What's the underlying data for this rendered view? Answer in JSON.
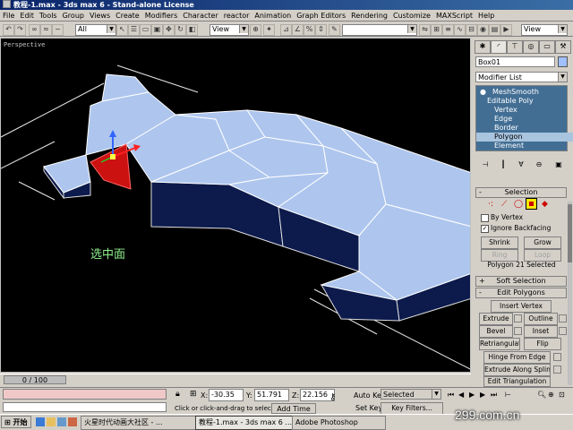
{
  "window": {
    "title": "教程-1.max - 3ds max 6 - Stand-alone License"
  },
  "menu": [
    "File",
    "Edit",
    "Tools",
    "Group",
    "Views",
    "Create",
    "Modifiers",
    "Character",
    "reactor",
    "Animation",
    "Graph Editors",
    "Rendering",
    "Customize",
    "MAXScript",
    "Help"
  ],
  "toolbar": {
    "filter_value": "All",
    "refcoord_value": "View",
    "named_sel_value": "",
    "right_view_value": "View"
  },
  "viewport": {
    "label": "Perspective",
    "annotation": "选中面"
  },
  "command_panel": {
    "object_name": "Box01",
    "modifier_list_label": "Modifier List",
    "stack": [
      {
        "label": "MeshSmooth",
        "selected": false
      },
      {
        "label": "Editable Poly",
        "selected": false
      },
      {
        "label": "Vertex",
        "selected": false
      },
      {
        "label": "Edge",
        "selected": false
      },
      {
        "label": "Border",
        "selected": false
      },
      {
        "label": "Polygon",
        "selected": true
      },
      {
        "label": "Element",
        "selected": false
      }
    ],
    "selection_rollout": "Selection",
    "by_vertex_label": "By Vertex",
    "ignore_backfacing_label": "Ignore Backfacing",
    "shrink_label": "Shrink",
    "grow_label": "Grow",
    "ring_label": "Ring",
    "loop_label": "Loop",
    "selection_status": "Polygon 21 Selected",
    "soft_selection_rollout": "Soft Selection",
    "edit_polygons_rollout": "Edit Polygons",
    "insert_vertex_label": "Insert Vertex",
    "extrude_label": "Extrude",
    "outline_label": "Outline",
    "bevel_label": "Bevel",
    "inset_label": "Inset",
    "retriangulate_label": "Retriangulate",
    "flip_label": "Flip",
    "hinge_label": "Hinge From Edge",
    "extrude_spline_label": "Extrude Along Spline",
    "edit_triangulation_label": "Edit Triangulation"
  },
  "timeline": {
    "frame": "0 / 100"
  },
  "status": {
    "x_label": "X:",
    "x_value": "-30.35",
    "y_label": "Y:",
    "y_value": "51.791",
    "z_label": "Z:",
    "z_value": "22.156",
    "prompt": "Click or click-and-drag to select obj",
    "add_time_tag": "Add Time Tag",
    "auto_key": "Auto Key",
    "set_key": "Set Key",
    "selected_value": "Selected",
    "key_filters": "Key Filters..."
  },
  "taskbar": {
    "start_label": "开始",
    "tasks": [
      "火星时代动画大社区 - ...",
      "教程-1.max - 3ds max 6 ...",
      "Adobe Photoshop"
    ]
  },
  "watermark": "299.com.cn",
  "colors": {
    "titlebar": "#0a246a",
    "viewport_bg": "#000000",
    "mesh_face": "#aec6ee",
    "selected_face": "#cc1111",
    "annotation": "#8df08d"
  }
}
